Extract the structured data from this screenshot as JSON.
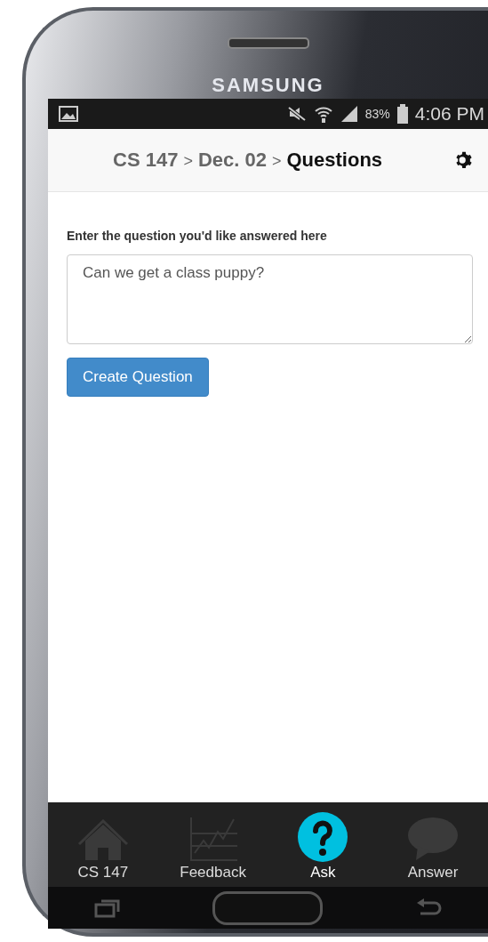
{
  "device": {
    "brand": "SAMSUNG"
  },
  "status_bar": {
    "battery": "83%",
    "time": "4:06 PM"
  },
  "breadcrumb": [
    {
      "kind": "crumb",
      "text": "CS 147",
      "current": false
    },
    {
      "kind": "separator",
      "text": ">"
    },
    {
      "kind": "crumb",
      "text": "Dec. 02",
      "current": false
    },
    {
      "kind": "separator",
      "text": ">"
    },
    {
      "kind": "crumb",
      "text": "Questions",
      "current": true
    }
  ],
  "form": {
    "label": "Enter the question you'd like answered here",
    "value": "Can we get a class puppy?",
    "button": "Create Question"
  },
  "nav": [
    {
      "kind": "home",
      "label": "CS 147",
      "selected": false
    },
    {
      "kind": "chart",
      "label": "Feedback",
      "selected": false
    },
    {
      "kind": "ask",
      "label": "Ask",
      "selected": true
    },
    {
      "kind": "answer",
      "label": "Answer",
      "selected": false
    }
  ]
}
